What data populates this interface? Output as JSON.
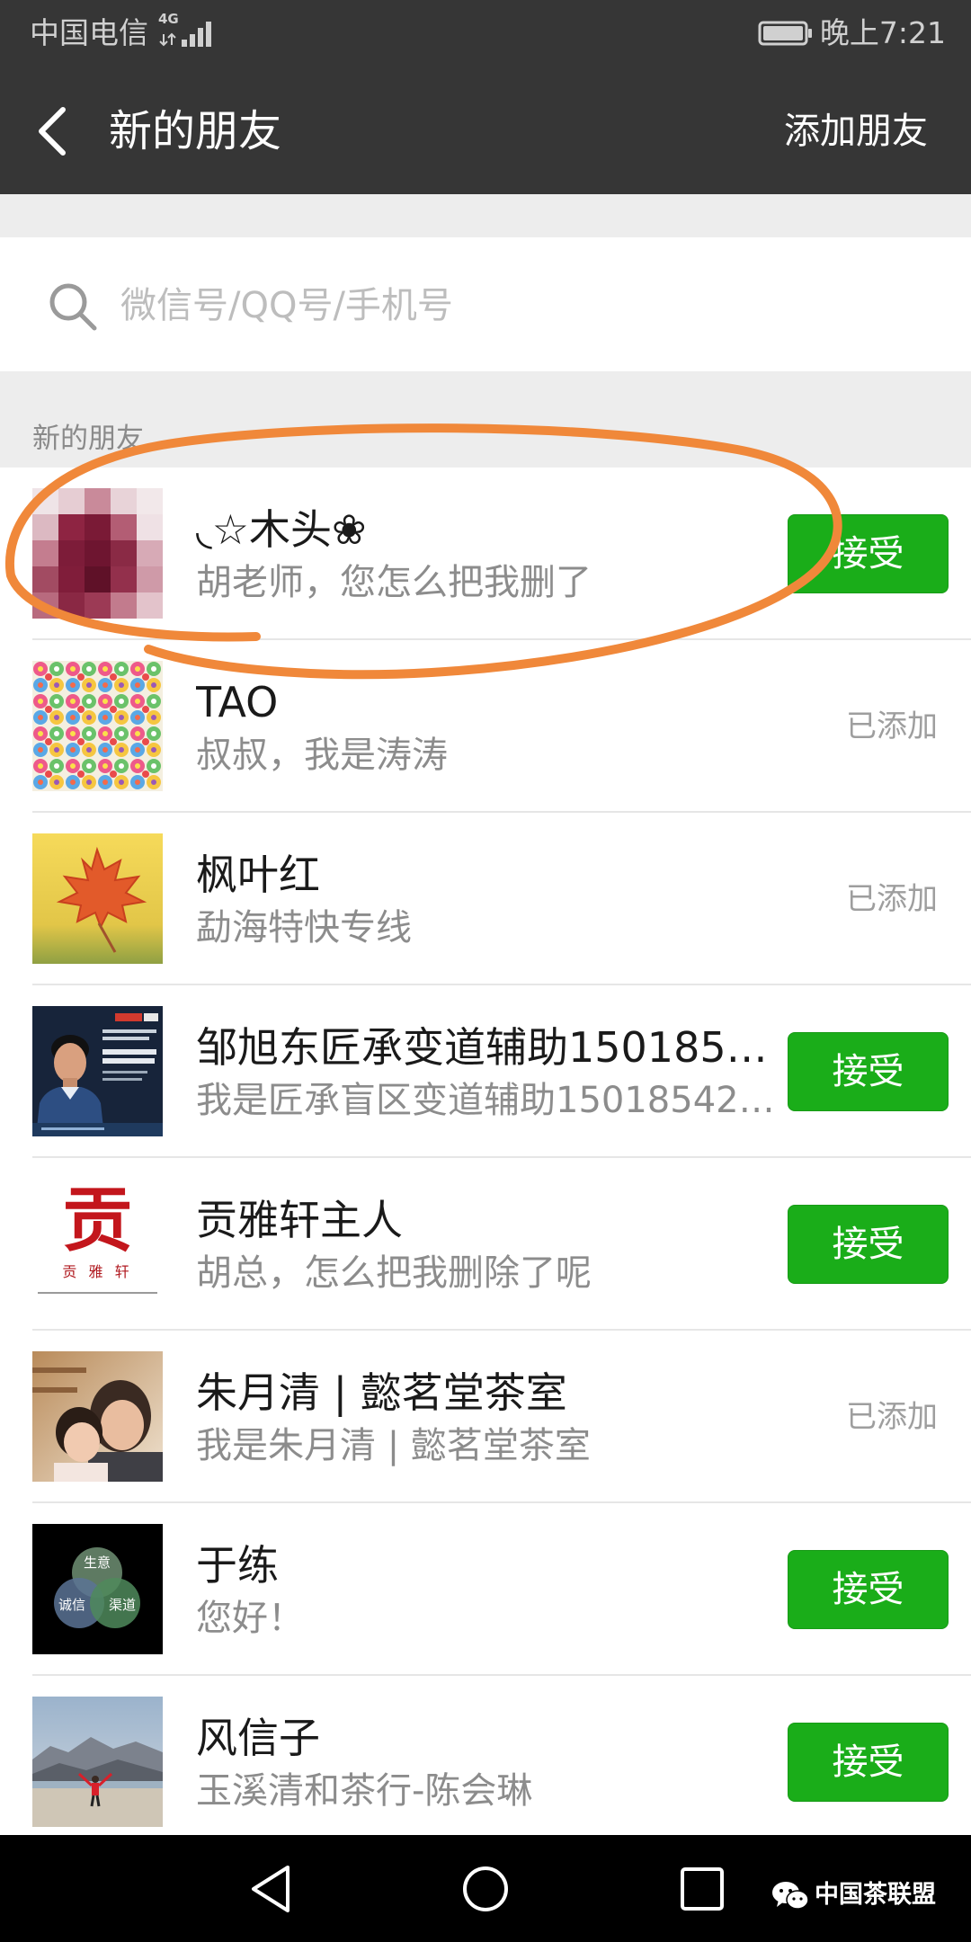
{
  "status_bar": {
    "carrier": "中国电信",
    "network": "4G",
    "time": "晚上7:21"
  },
  "header": {
    "title": "新的朋友",
    "add_friend": "添加朋友"
  },
  "search": {
    "placeholder": "微信号/QQ号/手机号"
  },
  "section": {
    "title": "新的朋友"
  },
  "friends": [
    {
      "name": "◟☆木头❀",
      "message": "胡老师，您怎么把我删了",
      "action": "接受",
      "accepted": false
    },
    {
      "name": "TAO",
      "message": "叔叔，我是涛涛",
      "action": "已添加",
      "accepted": true
    },
    {
      "name": "枫叶红",
      "message": "勐海特快专线",
      "action": "已添加",
      "accepted": true
    },
    {
      "name": "邹旭东匠承变道辅助1501854…",
      "message": "我是匠承盲区变道辅助15018542…",
      "action": "接受",
      "accepted": false
    },
    {
      "name": "贡雅轩主人",
      "message": "胡总，怎么把我删除了呢",
      "action": "接受",
      "accepted": false,
      "avatar_logo": {
        "mark": "贡",
        "caption": "贡 雅 轩"
      }
    },
    {
      "name": "朱月清 | 懿茗堂茶室",
      "message": "我是朱月清 | 懿茗堂茶室",
      "action": "已添加",
      "accepted": true
    },
    {
      "name": "于练",
      "message": "您好！",
      "action": "接受",
      "accepted": false,
      "avatar_logo": {
        "top": "生意",
        "left": "诚信",
        "right": "渠道"
      }
    },
    {
      "name": "风信子",
      "message": "玉溪清和茶行-陈会琳",
      "action": "接受",
      "accepted": false
    }
  ],
  "watermark": {
    "text": "中国茶联盟"
  },
  "icons": {
    "back": "chevron-left-icon",
    "search": "search-icon",
    "signal": "signal-icon",
    "battery": "battery-icon",
    "nav_back": "triangle-back-icon",
    "nav_home": "circle-home-icon",
    "nav_recents": "square-recents-icon",
    "watermark": "wechat-icon"
  },
  "colors": {
    "bar_background": "#363636",
    "page_background": "#ededed",
    "accept_button": "#1aad19",
    "annotation": "#f0883a"
  }
}
